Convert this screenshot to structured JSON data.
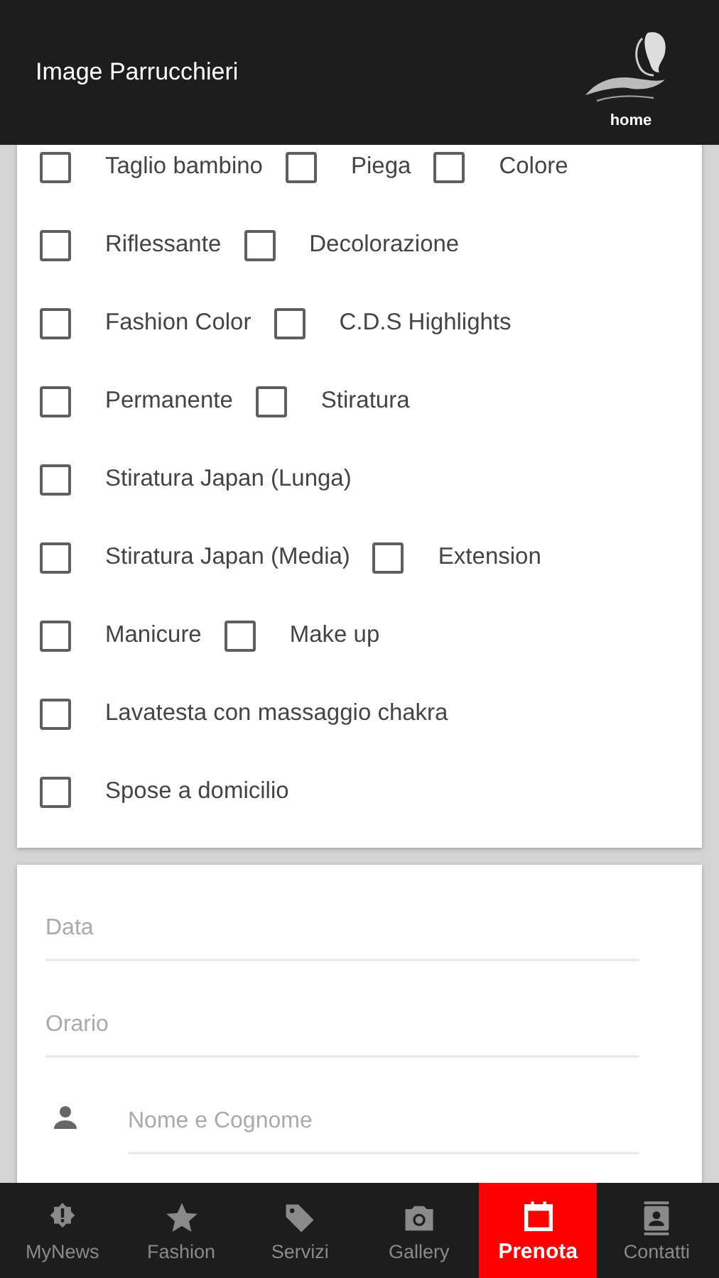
{
  "header": {
    "title": "Image Parrucchieri",
    "logo_caption": "home"
  },
  "services": [
    {
      "options": [
        {
          "label": "Taglio bambino",
          "checked": false
        },
        {
          "label": "Piega",
          "checked": false
        },
        {
          "label": "Colore",
          "checked": false
        }
      ]
    },
    {
      "options": [
        {
          "label": "Riflessante",
          "checked": false
        },
        {
          "label": "Decolorazione",
          "checked": false
        }
      ]
    },
    {
      "options": [
        {
          "label": "Fashion Color",
          "checked": false
        },
        {
          "label": "C.D.S Highlights",
          "checked": false
        }
      ]
    },
    {
      "options": [
        {
          "label": "Permanente",
          "checked": false
        },
        {
          "label": "Stiratura",
          "checked": false
        }
      ]
    },
    {
      "options": [
        {
          "label": "Stiratura Japan (Lunga)",
          "checked": false
        }
      ]
    },
    {
      "options": [
        {
          "label": "Stiratura Japan (Media)",
          "checked": false
        },
        {
          "label": "Extension",
          "checked": false
        }
      ]
    },
    {
      "options": [
        {
          "label": "Manicure",
          "checked": false
        },
        {
          "label": "Make up",
          "checked": false
        }
      ]
    },
    {
      "options": [
        {
          "label": "Lavatesta con massaggio chakra",
          "checked": false
        }
      ]
    },
    {
      "options": [
        {
          "label": "Spose a domicilio",
          "checked": false
        }
      ]
    }
  ],
  "form": {
    "fields": [
      {
        "kind": "plain",
        "placeholder": "Data"
      },
      {
        "kind": "plain",
        "placeholder": "Orario"
      },
      {
        "kind": "person",
        "placeholder": "Nome e Cognome"
      }
    ]
  },
  "nav": [
    {
      "kind": "news",
      "label": "MyNews",
      "selected": false
    },
    {
      "kind": "fashion",
      "label": "Fashion",
      "selected": false
    },
    {
      "kind": "services",
      "label": "Servizi",
      "selected": false
    },
    {
      "kind": "gallery",
      "label": "Gallery",
      "selected": false
    },
    {
      "kind": "booking",
      "label": "Prenota",
      "selected": true
    },
    {
      "kind": "contacts",
      "label": "Contatti",
      "selected": false
    }
  ]
}
